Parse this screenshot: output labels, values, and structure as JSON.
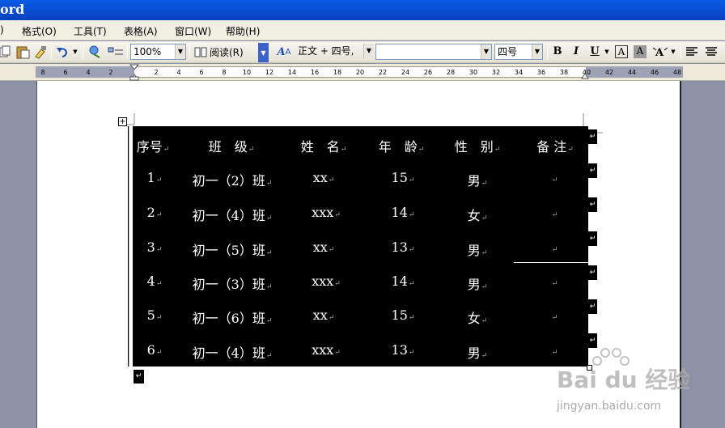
{
  "window": {
    "title": "ord"
  },
  "menu": {
    "items": [
      ") ",
      "格式(O)",
      "工具(T)",
      "表格(A)",
      "窗口(W)",
      "帮助(H)"
    ]
  },
  "toolbar": {
    "zoom": "100%",
    "read_label": "阅读(R)",
    "style": "正文 + 四号,",
    "font": "",
    "size": "四号",
    "bold": "B",
    "italic": "I",
    "underline": "U",
    "border_a": "A",
    "shade_a": "A"
  },
  "ruler": {
    "ticks": [
      "8",
      "6",
      "4",
      "2",
      "2",
      "4",
      "6",
      "8",
      "10",
      "12",
      "14",
      "16",
      "18",
      "20",
      "22",
      "24",
      "26",
      "28",
      "30",
      "32",
      "34",
      "36",
      "38",
      "40",
      "42",
      "44",
      "46",
      "48"
    ]
  },
  "table": {
    "headers": [
      "序号",
      "班　级",
      "姓　名",
      "年　龄",
      "性　别",
      "备 注"
    ],
    "rows": [
      [
        "1",
        "初一（2）班",
        "xx",
        "15",
        "男",
        ""
      ],
      [
        "2",
        "初一（4）班",
        "xxx",
        "14",
        "女",
        ""
      ],
      [
        "3",
        "初一（5）班",
        "xx",
        "13",
        "男",
        ""
      ],
      [
        "4",
        "初一（3）班",
        "xxx",
        "14",
        "男",
        ""
      ],
      [
        "5",
        "初一（6）班",
        "xx",
        "15",
        "女",
        ""
      ],
      [
        "6",
        "初一（4）班",
        "xxx",
        "13",
        "男",
        ""
      ]
    ],
    "paragraph_mark": "↵",
    "move_handle": "+"
  },
  "watermark": {
    "logo": "Bai du 经验",
    "url": "jingyan.baidu.com"
  }
}
